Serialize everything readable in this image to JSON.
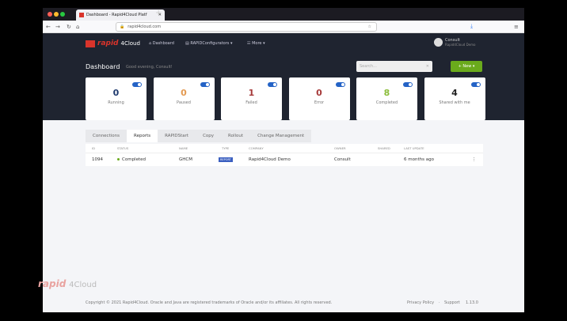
{
  "browser": {
    "tab_title": "Dashboard - Rapid4Cloud Platf",
    "url": "rapid4cloud.com"
  },
  "header": {
    "logo": "rapid 4Cloud",
    "nav": [
      "Dashboard",
      "RAPIDConfigurators",
      "More"
    ],
    "user_name": "Consult",
    "user_org": "Rapid4Cloud Demo"
  },
  "page": {
    "title": "Dashboard",
    "greeting": "Good evening, Consult!",
    "search_placeholder": "Search...",
    "new_label": "+ New"
  },
  "cards": [
    {
      "value": "0",
      "label": "Running",
      "color": "#1f3a6e"
    },
    {
      "value": "0",
      "label": "Paused",
      "color": "#e39a52"
    },
    {
      "value": "1",
      "label": "Failed",
      "color": "#a63a3a"
    },
    {
      "value": "0",
      "label": "Error",
      "color": "#a63a3a"
    },
    {
      "value": "8",
      "label": "Completed",
      "color": "#8bbd3a"
    },
    {
      "value": "4",
      "label": "Shared with me",
      "color": "#222"
    }
  ],
  "tabs": [
    "Connections",
    "Reports",
    "RAPIDStart",
    "Copy",
    "Rollout",
    "Change Management"
  ],
  "table": {
    "columns": [
      "ID",
      "STATUS",
      "NAME",
      "TYPE",
      "COMPANY",
      "OWNER",
      "SHARED",
      "LAST UPDATE"
    ],
    "rows": [
      {
        "id": "1094",
        "status": "Completed",
        "name": "GHCM",
        "type": "REPORT",
        "company": "Rapid4Cloud Demo",
        "owner": "Consult",
        "shared": "",
        "updated": "6 months ago"
      }
    ]
  },
  "footer": {
    "copyright": "Copyright © 2021 Rapid4Cloud. Oracle and Java are registered trademarks of Oracle and/or its affiliates. All rights reserved.",
    "privacy": "Privacy Policy",
    "support": "Support",
    "version": "1.13.0"
  },
  "watermark": "rapid 4Cloud"
}
